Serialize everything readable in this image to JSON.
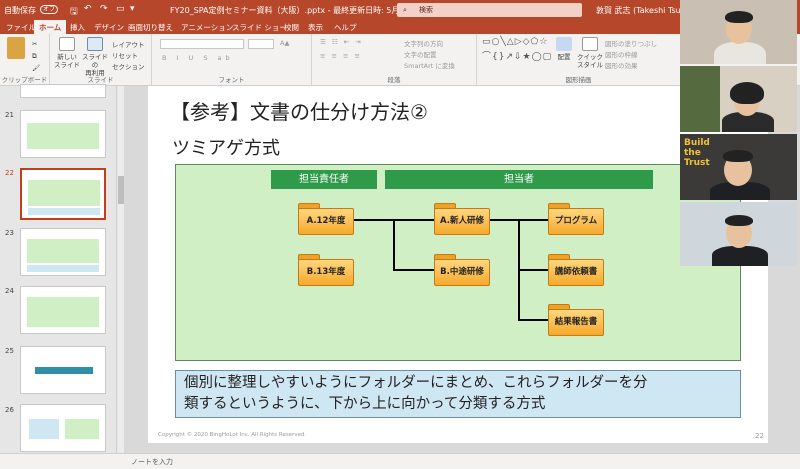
{
  "titlebar": {
    "autosave": "自動保存",
    "autosave_state": "オフ",
    "document": "FY20_SPA定例セミナー資料（大阪）.pptx - 最終更新日時: 5月3日",
    "search_placeholder": "検索",
    "user": "敦賀 武志 (Takeshi Tsuruga)"
  },
  "tabs": [
    "ファイル",
    "ホーム",
    "挿入",
    "デザイン",
    "画面切り替え",
    "アニメーション",
    "スライド ショー",
    "校閲",
    "表示",
    "ヘルプ"
  ],
  "active_tab": "ホーム",
  "ribbon": {
    "clipboard": {
      "label": "クリップボード",
      "paste": "貼り付け"
    },
    "slides": {
      "label": "スライド",
      "new_slide": "新しい\nスライド",
      "reuse": "スライドの\n再利用",
      "layout": "レイアウト",
      "reset": "リセット",
      "section": "セクション"
    },
    "font": {
      "label": "フォント"
    },
    "paragraph": {
      "label": "段落",
      "text_direction": "文字列の方向",
      "align_text": "文字の配置",
      "smartart": "SmartArt に変換"
    },
    "drawing": {
      "label": "図形描画",
      "arrange": "配置",
      "quick_styles": "クイック\nスタイル",
      "shape_fill": "図形の塗りつぶし",
      "shape_outline": "図形の枠線",
      "shape_effects": "図形の効果"
    }
  },
  "thumbnails": [
    {
      "num": "21"
    },
    {
      "num": "22",
      "selected": true
    },
    {
      "num": "23"
    },
    {
      "num": "24"
    },
    {
      "num": "25"
    },
    {
      "num": "26"
    }
  ],
  "slide": {
    "title": "【参考】文書の仕分け方法②",
    "subtitle": "ツミアゲ方式",
    "header_left": "担当責任者",
    "header_right": "担当者",
    "folders": {
      "a12": "A.12年度",
      "b13": "B.13年度",
      "a_new": "A.新人研修",
      "b_mid": "B.中途研修",
      "program": "プログラム",
      "lecturer": "講師依頼書",
      "report": "結果報告書"
    },
    "caption_line1": "個別に整理しやすいようにフォルダーにまとめ、これらフォルダーを分",
    "caption_line2": "類するというように、下から上に向かって分類する方式",
    "copyright": "Copyright © 2020 BingHoLot Inc. All Rights Reserved.",
    "page": "22"
  },
  "notes_placeholder": "ノートを入力",
  "video": {
    "tile3_text": "Build the Trust",
    "colors": {
      "accent": "#b7472a",
      "folder": "#f6a92c",
      "header_green": "#2f9a4a"
    }
  }
}
